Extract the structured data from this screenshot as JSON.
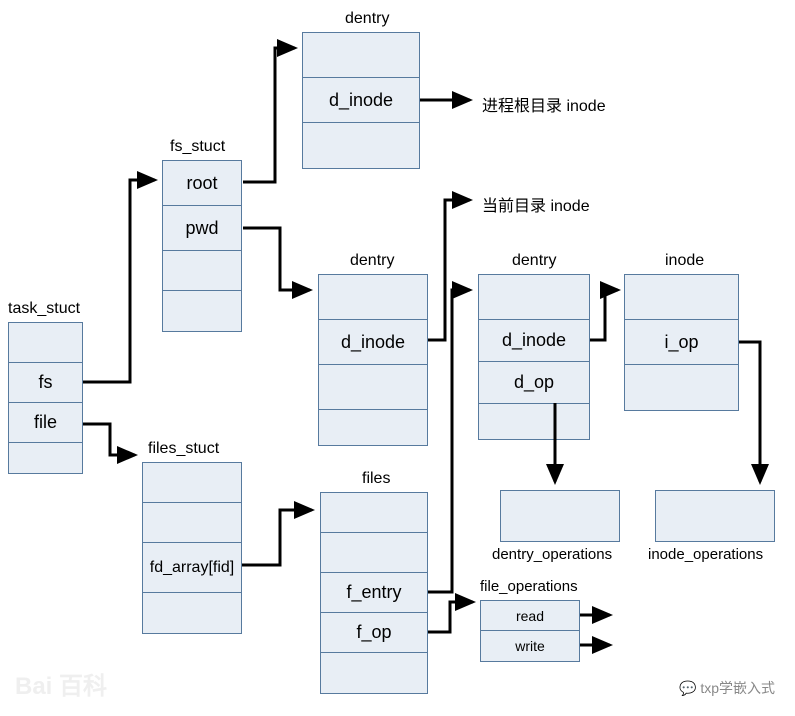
{
  "structs": {
    "task_struct": {
      "title": "task_stuct",
      "cells": [
        "",
        "fs",
        "file",
        ""
      ]
    },
    "fs_struct": {
      "title": "fs_stuct",
      "cells": [
        "root",
        "pwd",
        "",
        ""
      ]
    },
    "dentry1": {
      "title": "dentry",
      "cells": [
        "",
        "d_inode",
        ""
      ]
    },
    "dentry2": {
      "title": "dentry",
      "cells": [
        "",
        "d_inode",
        "",
        ""
      ]
    },
    "dentry3": {
      "title": "dentry",
      "cells": [
        "",
        "d_inode",
        "d_op",
        ""
      ]
    },
    "inode": {
      "title": "inode",
      "cells": [
        "",
        "i_op",
        ""
      ]
    },
    "files_struct": {
      "title": "files_stuct",
      "cells": [
        "",
        "",
        "fd_array[fid]",
        ""
      ]
    },
    "files": {
      "title": "files",
      "cells": [
        "",
        "",
        "f_entry",
        "f_op",
        ""
      ]
    },
    "file_operations": {
      "title": "file_operations",
      "cells": [
        "read",
        "write"
      ]
    },
    "dentry_ops": {
      "title": "dentry_operations"
    },
    "inode_ops": {
      "title": "inode_operations"
    }
  },
  "labels": {
    "root_inode": "进程根目录 inode",
    "pwd_inode": "当前目录 inode"
  },
  "watermarks": {
    "left": "Bai 百科",
    "right": "txp学嵌入式"
  }
}
